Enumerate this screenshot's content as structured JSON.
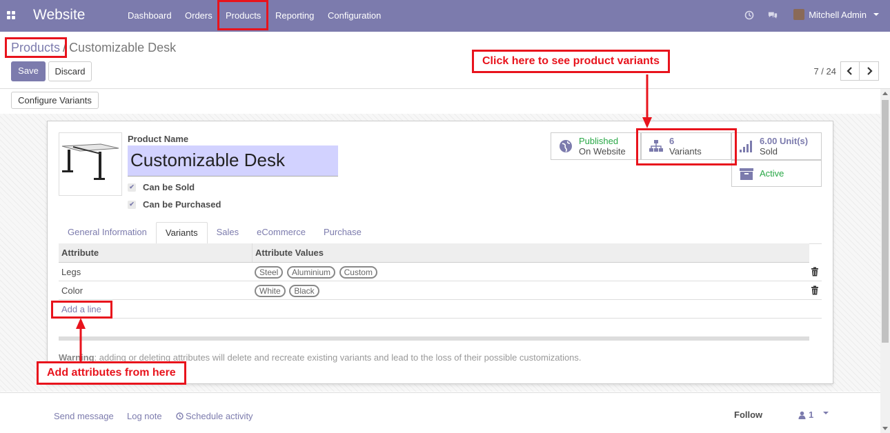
{
  "navbar": {
    "brand": "Website",
    "menu": [
      "Dashboard",
      "Orders",
      "Products",
      "Reporting",
      "Configuration"
    ],
    "user": "Mitchell Admin",
    "color": "#7c7bad"
  },
  "breadcrumb": {
    "parent": "Products",
    "separator": "/",
    "current": "Customizable Desk"
  },
  "actions": {
    "save": "Save",
    "discard": "Discard",
    "configure_variants": "Configure Variants"
  },
  "pager": {
    "value": "7 / 24",
    "prev": "‹",
    "next": "›"
  },
  "product": {
    "name_label": "Product Name",
    "name": "Customizable Desk",
    "can_be_sold": "Can be Sold",
    "can_be_purchased": "Can be Purchased"
  },
  "smart_buttons": {
    "published_top": "Published",
    "published_bottom": "On Website",
    "variants_count": "6",
    "variants_label": "Variants",
    "sold_qty": "6.00",
    "sold_unit": "Unit(s)",
    "sold_label": "Sold",
    "active_label": "Active"
  },
  "tabs": [
    "General Information",
    "Variants",
    "Sales",
    "eCommerce",
    "Purchase"
  ],
  "active_tab": "Variants",
  "table": {
    "headers": [
      "Attribute",
      "Attribute Values"
    ],
    "rows": [
      {
        "attribute": "Legs",
        "values": [
          "Steel",
          "Aluminium",
          "Custom"
        ]
      },
      {
        "attribute": "Color",
        "values": [
          "White",
          "Black"
        ]
      }
    ],
    "add_line": "Add a line"
  },
  "warning": {
    "bold": "Warning",
    "text": ": adding or deleting attributes will delete and recreate existing variants and lead to the loss of their possible customizations."
  },
  "chatter": {
    "send_message": "Send message",
    "log_note": "Log note",
    "schedule_activity": "Schedule activity",
    "follow": "Follow",
    "followers": "1"
  },
  "annotations": {
    "variants_callout": "Click here to see product variants",
    "attributes_callout": "Add attributes from here",
    "color": "#e8131c"
  }
}
